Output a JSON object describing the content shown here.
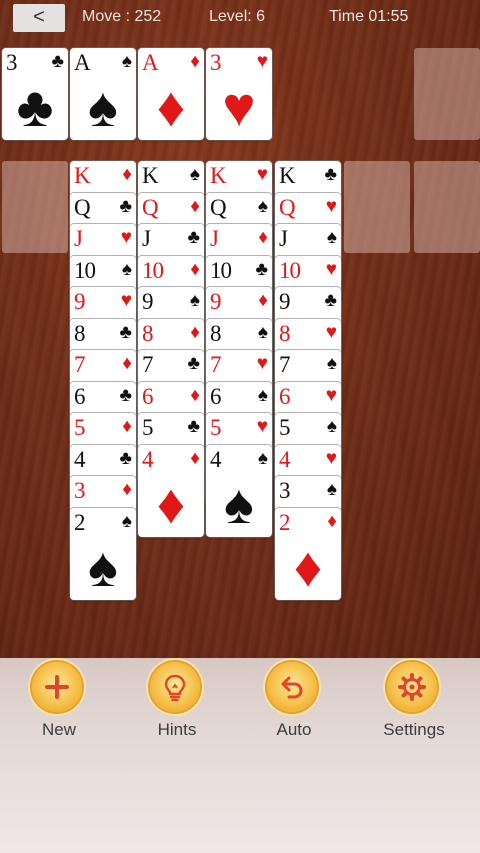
{
  "header": {
    "back_label": "<",
    "move_text": "Move : 252",
    "level_text": "Level: 6",
    "time_text": "Time 01:55"
  },
  "foundations": [
    {
      "rank": "3",
      "suit": "♣",
      "color": "black"
    },
    {
      "rank": "A",
      "suit": "♠",
      "color": "black"
    },
    {
      "rank": "A",
      "suit": "♦",
      "color": "red"
    },
    {
      "rank": "3",
      "suit": "♥",
      "color": "red"
    }
  ],
  "tableau": [
    [
      {
        "rank": "K",
        "suit": "♦",
        "color": "red"
      },
      {
        "rank": "Q",
        "suit": "♣",
        "color": "black"
      },
      {
        "rank": "J",
        "suit": "♥",
        "color": "red"
      },
      {
        "rank": "10",
        "suit": "♠",
        "color": "black"
      },
      {
        "rank": "9",
        "suit": "♥",
        "color": "red"
      },
      {
        "rank": "8",
        "suit": "♣",
        "color": "black"
      },
      {
        "rank": "7",
        "suit": "♦",
        "color": "red"
      },
      {
        "rank": "6",
        "suit": "♣",
        "color": "black"
      },
      {
        "rank": "5",
        "suit": "♦",
        "color": "red"
      },
      {
        "rank": "4",
        "suit": "♣",
        "color": "black"
      },
      {
        "rank": "3",
        "suit": "♦",
        "color": "red"
      },
      {
        "rank": "2",
        "suit": "♠",
        "color": "black"
      }
    ],
    [
      {
        "rank": "K",
        "suit": "♠",
        "color": "black"
      },
      {
        "rank": "Q",
        "suit": "♦",
        "color": "red"
      },
      {
        "rank": "J",
        "suit": "♣",
        "color": "black"
      },
      {
        "rank": "10",
        "suit": "♦",
        "color": "red"
      },
      {
        "rank": "9",
        "suit": "♠",
        "color": "black"
      },
      {
        "rank": "8",
        "suit": "♦",
        "color": "red"
      },
      {
        "rank": "7",
        "suit": "♣",
        "color": "black"
      },
      {
        "rank": "6",
        "suit": "♦",
        "color": "red"
      },
      {
        "rank": "5",
        "suit": "♣",
        "color": "black"
      },
      {
        "rank": "4",
        "suit": "♦",
        "color": "red"
      }
    ],
    [
      {
        "rank": "K",
        "suit": "♥",
        "color": "red"
      },
      {
        "rank": "Q",
        "suit": "♠",
        "color": "black"
      },
      {
        "rank": "J",
        "suit": "♦",
        "color": "red"
      },
      {
        "rank": "10",
        "suit": "♣",
        "color": "black"
      },
      {
        "rank": "9",
        "suit": "♦",
        "color": "red"
      },
      {
        "rank": "8",
        "suit": "♠",
        "color": "black"
      },
      {
        "rank": "7",
        "suit": "♥",
        "color": "red"
      },
      {
        "rank": "6",
        "suit": "♠",
        "color": "black"
      },
      {
        "rank": "5",
        "suit": "♥",
        "color": "red"
      },
      {
        "rank": "4",
        "suit": "♠",
        "color": "black"
      }
    ],
    [
      {
        "rank": "K",
        "suit": "♣",
        "color": "black"
      },
      {
        "rank": "Q",
        "suit": "♥",
        "color": "red"
      },
      {
        "rank": "J",
        "suit": "♠",
        "color": "black"
      },
      {
        "rank": "10",
        "suit": "♥",
        "color": "red"
      },
      {
        "rank": "9",
        "suit": "♣",
        "color": "black"
      },
      {
        "rank": "8",
        "suit": "♥",
        "color": "red"
      },
      {
        "rank": "7",
        "suit": "♠",
        "color": "black"
      },
      {
        "rank": "6",
        "suit": "♥",
        "color": "red"
      },
      {
        "rank": "5",
        "suit": "♠",
        "color": "black"
      },
      {
        "rank": "4",
        "suit": "♥",
        "color": "red"
      },
      {
        "rank": "3",
        "suit": "♠",
        "color": "black"
      },
      {
        "rank": "2",
        "suit": "♦",
        "color": "red"
      }
    ]
  ],
  "toolbar": {
    "new_label": "New",
    "hints_label": "Hints",
    "auto_label": "Auto",
    "settings_label": "Settings"
  },
  "colors": {
    "red_suit": "#e01818",
    "black_suit": "#111111",
    "button_gold": "#f6c04a",
    "table_wood": "#74301a"
  },
  "icons": {
    "new": "plus-icon",
    "hints": "lightbulb-icon",
    "auto": "undo-arrow-icon",
    "settings": "gear-icon"
  }
}
